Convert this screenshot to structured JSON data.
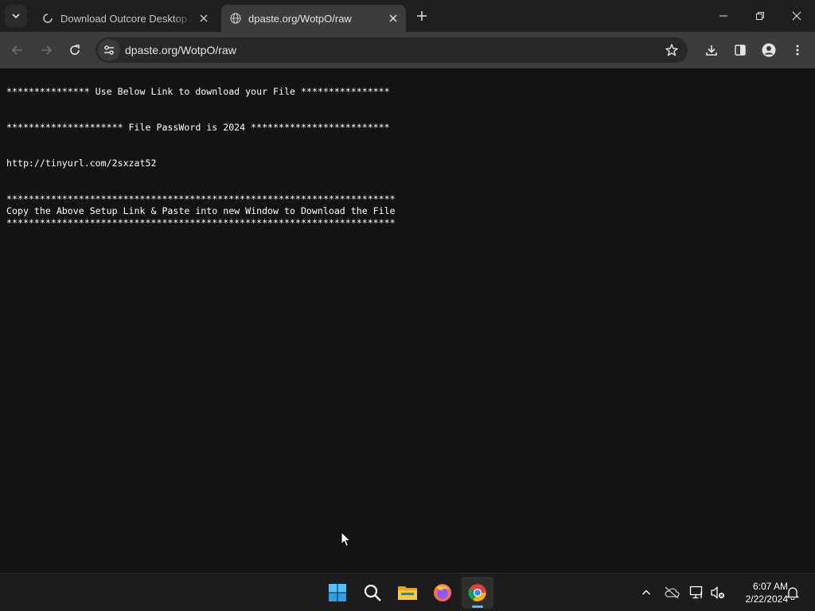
{
  "browser": {
    "tabs": [
      {
        "title": "Download Outcore Desktop Adventure",
        "active": false
      },
      {
        "title": "dpaste.org/WotpO/raw",
        "active": true
      }
    ],
    "address": "dpaste.org/WotpO/raw"
  },
  "page": {
    "lines": [
      "*************** Use Below Link to download your File ****************",
      "",
      "",
      "********************* File PassWord is 2024 *************************",
      "",
      "",
      "http://tinyurl.com/2sxzat52",
      "",
      "",
      "**********************************************************************",
      "Copy the Above Setup Link & Paste into new Window to Download the File",
      "**********************************************************************"
    ]
  },
  "taskbar": {
    "time": "6:07 AM",
    "date": "2/22/2024",
    "apps": [
      "windows-start",
      "search",
      "file-explorer",
      "firefox",
      "chrome"
    ]
  },
  "colors": {
    "accent": "#4cc2ff",
    "page_background": "#131313",
    "text": "#ffffff"
  }
}
